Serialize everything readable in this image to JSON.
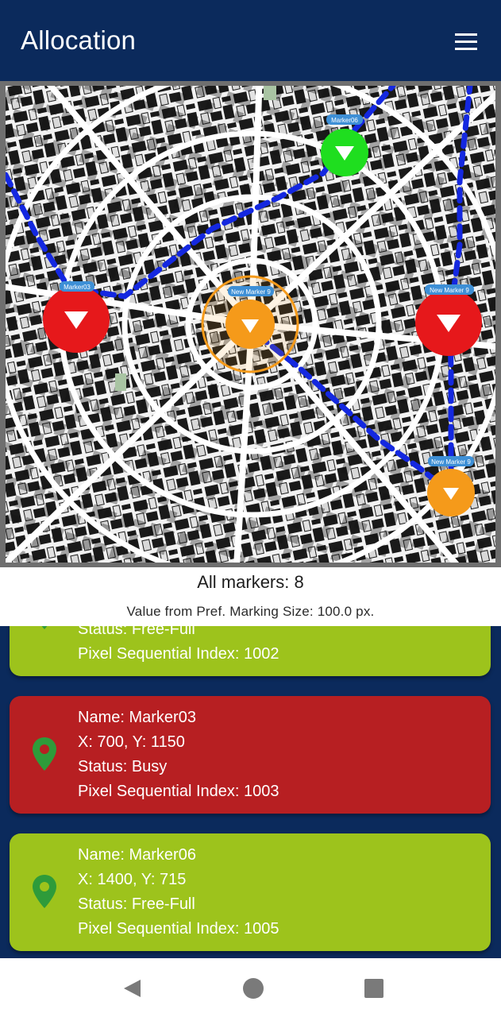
{
  "appbar": {
    "title": "Allocation",
    "menu_icon": "hamburger-menu-icon"
  },
  "map": {
    "markers": [
      {
        "label": "Marker03",
        "color": "#e6181b"
      },
      {
        "label": "Marker06",
        "color": "#1fde1f"
      },
      {
        "label": "New Marker 9",
        "color": "#f59a1a"
      },
      {
        "label": "New Marker 9",
        "color": "#e6181b"
      },
      {
        "label": "New Marker 9",
        "color": "#f59a1a"
      }
    ],
    "path_color": "#1428e0"
  },
  "summary": {
    "all_markers": "All markers: 8",
    "marking_size": "Value from Pref. Marking Size: 100.0 px."
  },
  "cards": [
    {
      "color": "#9dc31c",
      "lines": [
        "Status: Free-Full",
        "Pixel Sequential Index: 1002"
      ]
    },
    {
      "color": "#b71f22",
      "lines": [
        "Name: Marker03",
        "X: 700, Y: 1150",
        "Status: Busy",
        "Pixel Sequential Index: 1003"
      ]
    },
    {
      "color": "#9dc31c",
      "lines": [
        "Name: Marker06",
        "X: 1400, Y: 715",
        "Status: Free-Full",
        "Pixel Sequential Index: 1005"
      ]
    }
  ],
  "navbar": {
    "back_icon": "back-triangle-icon",
    "home_icon": "home-circle-icon",
    "recents_icon": "recents-square-icon"
  }
}
